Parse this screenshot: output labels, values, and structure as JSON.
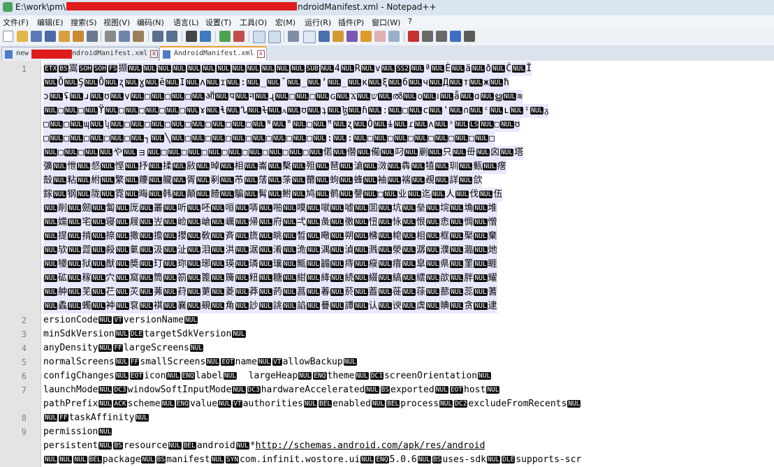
{
  "window": {
    "title_prefix": "E:\\work\\pm\\",
    "title_suffix": "ndroidManifest.xml - Notepad++"
  },
  "menu": [
    "文件(F)",
    "编辑(E)",
    "搜索(S)",
    "视图(V)",
    "编码(N)",
    "语言(L)",
    "设置(T)",
    "工具(O)",
    "宏(M)",
    "运行(R)",
    "插件(P)",
    "窗口(W)",
    "?"
  ],
  "tabs": {
    "tab1_prefix": "new",
    "tab1_suffix": "ndroidManifest.xml",
    "tab2_label": "AndroidManifest.xml",
    "close_glyph": "x"
  },
  "editor": {
    "line_numbers": [
      "1",
      "2",
      "3",
      "4",
      "5",
      "6",
      "7",
      "8",
      "9"
    ],
    "binary_lines": [
      "ETX BS 嵩 SOH SOH FS 撷 NUL NUL NUL NUL NUL NUL NUL NUL NUL NUL NUL NUL SUB NUL 4 NUL R NUL v NUL SS2 NUL ª NUL È NUL ä NUL ð NUL Ċ NUL Ĩ",
      "NUL Õ NUL Ş NUL Ō NUL ʐ NUL ɣ NUL ĕ NUL I NUL ʌ NUL ɪ NUL : NUL _ NUL ˇ NUL _ NUL ʻ NUL _ NUL ĸ NUL ξ NUL б NUL ч NUL Д NUL т NUL ж NUL ħ",
      "ɔ NUL ʢ NUL ɹ NUL ʊ NUL v NUL □ NUL □ NUL □ NUL ऑ NUL प NUL न NUL ɻ NUL □ NUL □ NUL ɢ NUL Ϫ NUL ש NUL ൽ NUL ൦ NUL ౹ NUL ǟ NUL ɑ NUL ൠ NUL ≋",
      "NUL □ NUL □ NUL ϔ NUL □ NUL □ NUL □ NUL □ NUL ɤ NUL ɬ NUL ᔐ NUL ɫ NUL ᴧ NUL ʊ NUL ʇ NUL ɮ NUL ɦ NUL ː NUL □ NUL ϲ NUL ' NUL ∩ NUL ᶜ NUL ʟ NUL ᶦ NUL ᵹ",
      "□ NUL □ NUL ɰ NUL ʮ NUL □ NUL □ NUL □ NUL □ NUL □ NUL □ NUL □ NUL ᴺ NUL ° NUL □ NUL ᴹ NUL ʐ NUL Ò NUL ɨ NUL ɾ NUL ʌ NUL ˢ NUL LS NUL □ NUL ʊ",
      "□ NUL □ NUL □ NUL □ NUL □ NUL ┐ NUL ╲ NUL □ NUL □ NUL □ NUL □ NUL □ NUL □ NUL □ NUL : NUL : NUL □ NUL □ NUL □ NUL □ NUL □ NUL □ NUL □",
      "NUL □ NUL □ NUL NUL や NUL ョ NUL □ NUL □ NUL □ NUL □ NUL □ NUL □ NUL □ NUL □ NUL 偌 NUL 僣 NUL 僃 NUL 叼 NUL 剻 NUL 只 NUL 毌 NUL 囟 NUL 塔",
      "彍 NUL 怈 NUL 惄 NUL 悭 NUL 抒 NUL 揉 NUL 敐 NUL 晫 NUL 相 NUL 崙 NUL 檕 NUL 殂 NUL 琶 NUL 滄 NUL 滧 NUL 犇 NUL 犆 NUL 玔 NUL 甀 NUL 瘔",
      "嗀 NUL 粘 NUL 紨 NUL 繁 NUL 羻 NUL 朧 NUL 胥 NUL 剢 NUL 芇 NUL 萿 NUL 蒤 NUL 薾 NUL 蚼 NUL 蜂 NUL 袖 NUL 褍 NUL 覕 NUL 詳 NUL 欱",
      "鎵 NUL 钢 NUL 陇 NUL 霓 NUL 晦 NUL 韩 NUL 顛 NUL 饐 NUL 騙 NUL 髾 NUL 鲋 NUL 鸠 NUL 鹡 NUL 謦 NUL □ NUL 业 NUL 迄 NUL 人 NUL 伐 NUL 伍",
      "NUL 削 NUL 劒 NUL 匐 NUL 厐 NUL 叢 NUL 听 NUL 呸 NUL 咺 NUL 哢 NUL 啪 NUL 嗼 NUL 噈 NUL 嘘 NUL 囬 NUL 坑 NUL 垒 NUL 垸 NUL 埆 NUL 堆",
      "NUL 嬬 NUL 宅 NUL 寝 NUL 屐 NUL 岦 NUL 崄 NUL 嵢 NUL 巁 NUL 帰 NUL 府 NUL 弌 NUL 彘 NUL 徼 NUL 忸 NUL 怺 NUL 恨 NUL 悆 NUL 惆 NUL 憎",
      "NUL 提 NUL 掯 NUL 捺 NUL 撒 NUL 擔 NUL 攖 NUL 敎 NUL 斉 NUL 旒 NUL 晀 NUL 晳 NUL 曔 NUL 朔 NUL 梻 NUL 梍 NUL 柤 NUL 框 NUL 棸 NUL 棄",
      "NUL 欤 NUL 歰 NUL 殺 NUL 氭 NUL 汲 NUL 沚 NUL 泪 NUL 洪 NUL 涺 NUL 淆 NUL 洈 NUL 湡 NUL 湞 NUL 溅 NUL 滎 NUL 潺 NUL 濮 NUL 瀶 NUL 灺",
      "NUL 犪 NUL 狱 NUL 猷 NUL 奬 NUL 玎 NUL 珎 NUL 琊 NUL 瑛 NUL 璘 NUL 瓖 NUL 甒 NUL 疈 NUL 痔 NUL 瘊 NUL 瘖 NUL 皐 NUL 県 NUL 罣 NUL 睚",
      "NUL 砿 NUL 稼 NUL 穴 NUL 窩 NUL 筒 NUL 箚 NUL 篦 NUL 簰 NUL 粈 NUL 糖 NUL 紺 NUL 絳 NUL 続 NUL 綴 NUL 縞 NUL 繧 NUL 欿 NUL 胖 NUL 耀",
      "NUL 舯 NUL 芜 NUL 芢 NUL 苂 NUL 茀 NUL 荮 NUL 莄 NUL 菱 NUL 莽 NUL 菂 NUL 菖 NUL 萶 NUL 菸 NUL 葢 NUL 蓰 NUL 蒣 NUL 蔀 NUL 蕊 NUL 蓍",
      "NUL 蟊 NUL 蠋 NUL 衶 NUL 袞 NUL 褀 NUL 襄 NUL 覡 NUL 角 NUL 訬 NUL 誂 NUL 諂 NUL 謈 NUL 譚 NUL 认 NUL 谀 NUL 虡 NUL 賟 NUL 贪 NUL 逮"
    ],
    "text_lines": [
      {
        "parts": [
          "ersionCode",
          "NUL",
          "VT",
          "versionName",
          "NUL"
        ]
      },
      {
        "parts": [
          "minSdkVersion",
          "NUL",
          "DLE",
          "targetSdkVersion",
          "NUL"
        ]
      },
      {
        "parts": [
          "anyDensity",
          "NUL",
          "FF",
          "largeScreens",
          "NUL"
        ]
      },
      {
        "parts": [
          "normalScreens",
          "NUL",
          "FF",
          "smallScreens",
          "NUL",
          "EOT",
          "name",
          "NUL",
          "VT",
          "allowBackup",
          "NUL"
        ]
      },
      {
        "parts": [
          "configChanges",
          "NUL",
          "EOT",
          "icon",
          "NUL",
          "ENQ",
          "label",
          "NUL",
          "  largeHeap",
          "NUL",
          "ENQ",
          "theme",
          "NUL",
          "DC1",
          "screenOrientation",
          "NUL"
        ]
      },
      {
        "parts": [
          "launchMode",
          "NUL",
          "DC3",
          "windowSoftInputMode",
          "NUL",
          "DC3",
          "hardwareAccelerated",
          "NUL",
          "BS",
          "exported",
          "NUL",
          "EOT",
          "host",
          "NUL"
        ]
      },
      {
        "parts": [
          "pathPrefix",
          "NUL",
          "ACK",
          "scheme",
          "NUL",
          "ENQ",
          "value",
          "NUL",
          "VT",
          "authorities",
          "NUL",
          "BEL",
          "enabled",
          "NUL",
          "BEL",
          "process",
          "NUL",
          "DC2",
          "excludeFromRecents",
          "NUL"
        ]
      },
      {
        "parts": [
          "NUL",
          "FF",
          "taskAffinity",
          "NUL"
        ]
      },
      {
        "parts": [
          "permission",
          "NUL"
        ]
      },
      {
        "parts": [
          "persistent",
          "NUL",
          "BS",
          "resource",
          "NUL",
          "BEL",
          "android",
          "NUL",
          "*",
          "http://schemas.android.com/apk/res/android"
        ]
      },
      {
        "parts": [
          "NUL",
          "NUL",
          "NUL",
          "BEL",
          "package",
          "NUL",
          "BS",
          "manifest",
          "NUL",
          "SYN",
          "com.infinit.wostore.ui",
          "NUL",
          "ENQ",
          "5.0.6",
          "NUL",
          "BS",
          "uses-sdk",
          "NUL",
          "DLE",
          "supports-scr"
        ]
      }
    ]
  }
}
